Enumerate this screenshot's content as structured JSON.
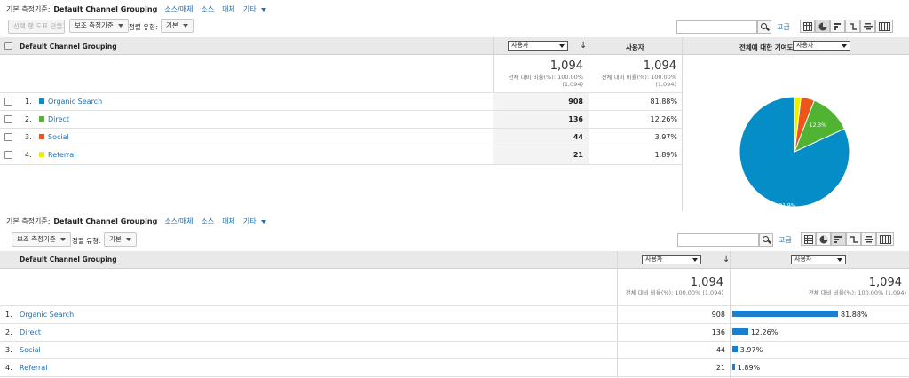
{
  "top": {
    "dim_bar": {
      "label": "기본 측정기준:",
      "current": "Default Channel Grouping",
      "links": [
        "소스/매체",
        "소스",
        "매체"
      ],
      "other": "기타"
    },
    "toolbar": {
      "secondary_btn": "선택 행 도표 만들기",
      "secondary_dim": "보조 측정기준",
      "sort_label": "정렬 유형:",
      "sort_value": "기본",
      "advanced": "고급"
    },
    "table": {
      "dim_header": "Default Channel Grouping",
      "metric_select": "사용자",
      "metric_header": "사용자",
      "contribution_label": "전체에 대한 기여도:",
      "contribution_select": "사용자",
      "total_value": "1,094",
      "total_pct_text": "전체 대비 비율(%): 100.00%",
      "total_paren": "(1,094)",
      "total_value2": "1,094",
      "total_pct_text2": "전체 대비 비율(%): 100.00%",
      "total_paren2": "(1,094)",
      "rows": [
        {
          "idx": "1.",
          "name": "Organic Search",
          "value": "908",
          "pct": "81.88%",
          "color": "#058dc7"
        },
        {
          "idx": "2.",
          "name": "Direct",
          "value": "136",
          "pct": "12.26%",
          "color": "#50b432"
        },
        {
          "idx": "3.",
          "name": "Social",
          "value": "44",
          "pct": "3.97%",
          "color": "#ed561b"
        },
        {
          "idx": "4.",
          "name": "Referral",
          "value": "21",
          "pct": "1.89%",
          "color": "#edef00"
        }
      ]
    },
    "pie": {
      "label_big": "81.9%",
      "label_second": "12.3%"
    }
  },
  "bottom": {
    "dim_bar": {
      "label": "기본 측정기준:",
      "current": "Default Channel Grouping",
      "links": [
        "소스/매체",
        "소스",
        "매체"
      ],
      "other": "기타"
    },
    "toolbar": {
      "secondary_dim": "보조 측정기준",
      "sort_label": "정렬 유형:",
      "sort_value": "기본",
      "advanced": "고급"
    },
    "table": {
      "dim_header": "Default Channel Grouping",
      "metric_select": "사용자",
      "compare_select": "사용자",
      "total_value": "1,094",
      "total_pct_text": "전체 대비 비율(%): 100.00% (1,094)",
      "total_value2": "1,094",
      "total_pct_text2": "전체 대비 비율(%): 100.00% (1,094)",
      "rows": [
        {
          "idx": "1.",
          "name": "Organic Search",
          "value": "908",
          "pct": "81.88%",
          "fraction": 0.8188
        },
        {
          "idx": "2.",
          "name": "Direct",
          "value": "136",
          "pct": "12.26%",
          "fraction": 0.1226
        },
        {
          "idx": "3.",
          "name": "Social",
          "value": "44",
          "pct": "3.97%",
          "fraction": 0.0397
        },
        {
          "idx": "4.",
          "name": "Referral",
          "value": "21",
          "pct": "1.89%",
          "fraction": 0.0189
        }
      ]
    }
  },
  "chart_data": [
    {
      "type": "pie",
      "categories": [
        "Organic Search",
        "Direct",
        "Social",
        "Referral"
      ],
      "values": [
        81.88,
        12.26,
        3.97,
        1.89
      ],
      "colors": [
        "#058dc7",
        "#50b432",
        "#ed561b",
        "#edef00"
      ],
      "labels": [
        "81.9%",
        "12.3%"
      ]
    },
    {
      "type": "bar",
      "categories": [
        "Organic Search",
        "Direct",
        "Social",
        "Referral"
      ],
      "values": [
        81.88,
        12.26,
        3.97,
        1.89
      ],
      "color": "#1a7fcf"
    }
  ],
  "icons": [
    "search-icon",
    "grid-view-icon",
    "pie-view-icon",
    "bar-view-icon",
    "comparison-view-icon",
    "term-cloud-icon",
    "pivot-view-icon"
  ]
}
